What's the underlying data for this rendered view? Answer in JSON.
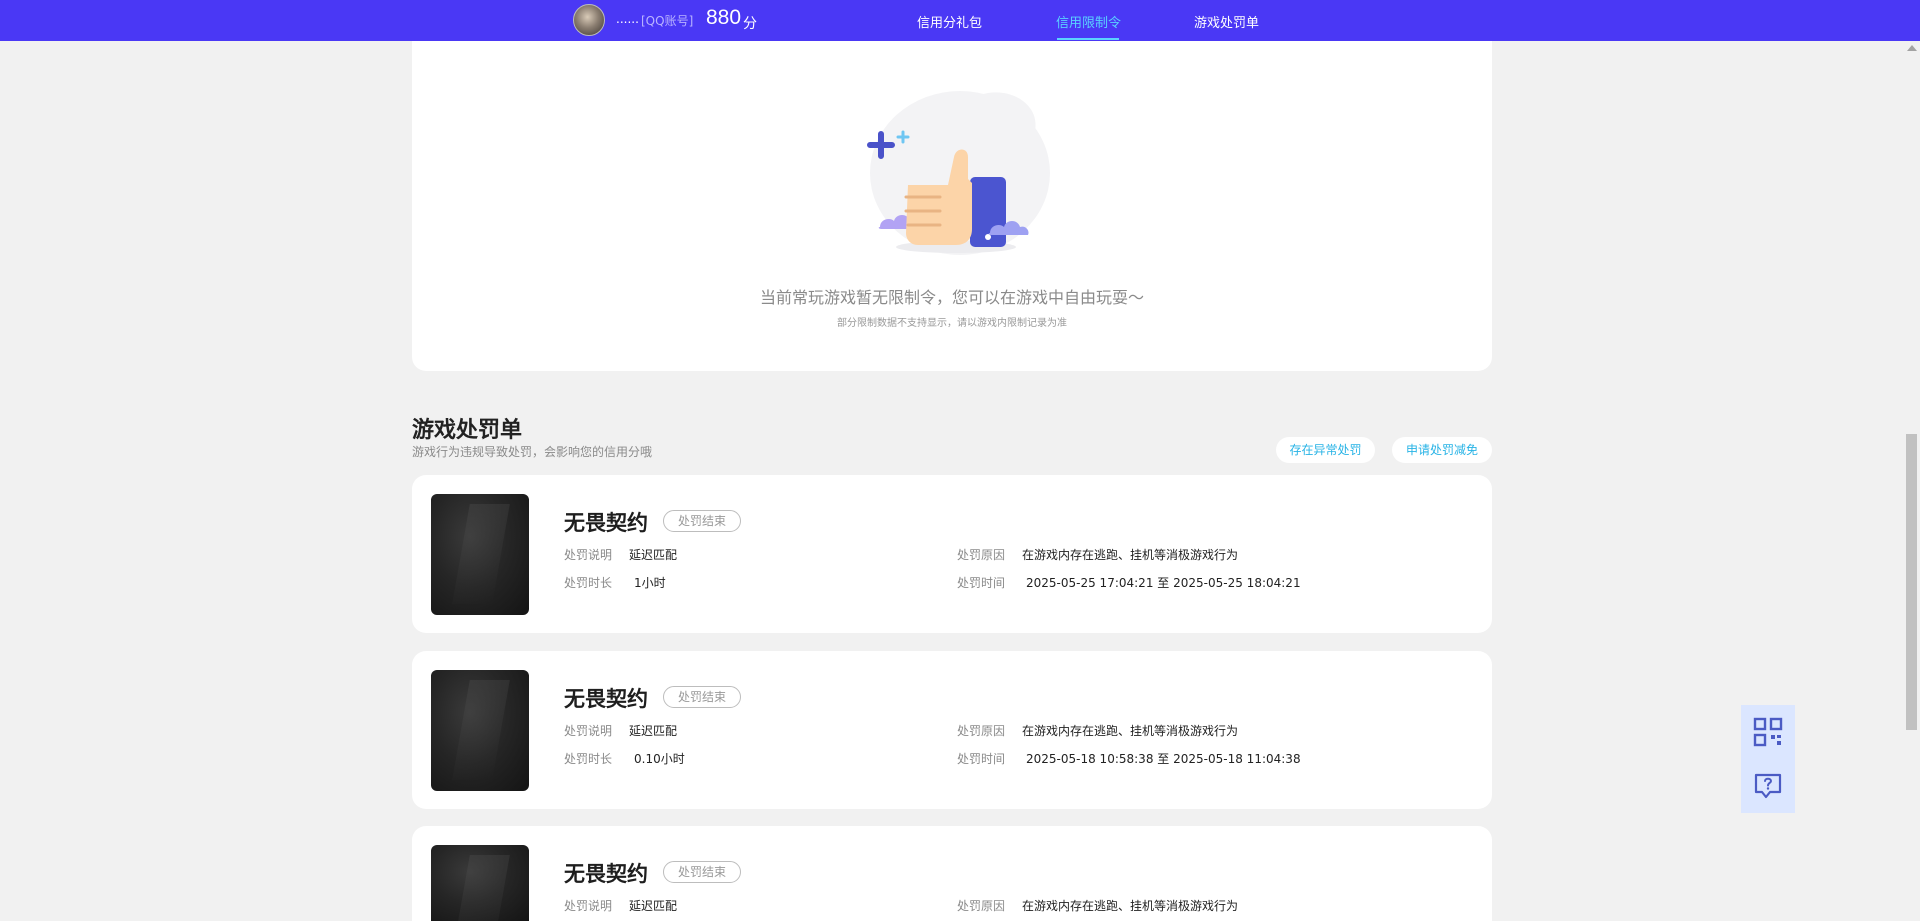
{
  "header": {
    "user_name": "......",
    "account_type": "[QQ账号]",
    "score": "880",
    "score_unit": "分",
    "tabs": [
      {
        "label": "信用分礼包",
        "active": false
      },
      {
        "label": "信用限制令",
        "active": true
      },
      {
        "label": "游戏处罚单",
        "active": false
      }
    ]
  },
  "restriction": {
    "empty_message": "当前常玩游戏暂无限制令，您可以在游戏中自由玩耍～",
    "empty_note": "部分限制数据不支持显示，请以游戏内限制记录为准"
  },
  "penalty_section": {
    "title": "游戏处罚单",
    "description": "游戏行为违规导致处罚，会影响您的信用分哦",
    "report_button": "存在异常处罚",
    "appeal_button": "申请处罚减免"
  },
  "field_labels": {
    "explain": "处罚说明",
    "duration": "处罚时长",
    "reason": "处罚原因",
    "time": "处罚时间",
    "to": "至"
  },
  "penalties": [
    {
      "game": "无畏契约",
      "status": "处罚结束",
      "explain": "延迟匹配",
      "duration": "1小时",
      "reason": "在游戏内存在逃跑、挂机等消极游戏行为",
      "start": "2025-05-25 17:04:21",
      "end": "2025-05-25 18:04:21"
    },
    {
      "game": "无畏契约",
      "status": "处罚结束",
      "explain": "延迟匹配",
      "duration": "0.10小时",
      "reason": "在游戏内存在逃跑、挂机等消极游戏行为",
      "start": "2025-05-18 10:58:38",
      "end": "2025-05-18 11:04:38"
    },
    {
      "game": "无畏契约",
      "status": "处罚结束",
      "explain": "延迟匹配",
      "reason": "在游戏内存在逃跑、挂机等消极游戏行为"
    }
  ],
  "side_buttons": [
    {
      "icon": "qr-code-icon"
    },
    {
      "icon": "help-chat-icon"
    }
  ],
  "colors": {
    "header_bg": "#4a38f5",
    "active_tab": "#5ad2ff",
    "link": "#27b3e6"
  }
}
